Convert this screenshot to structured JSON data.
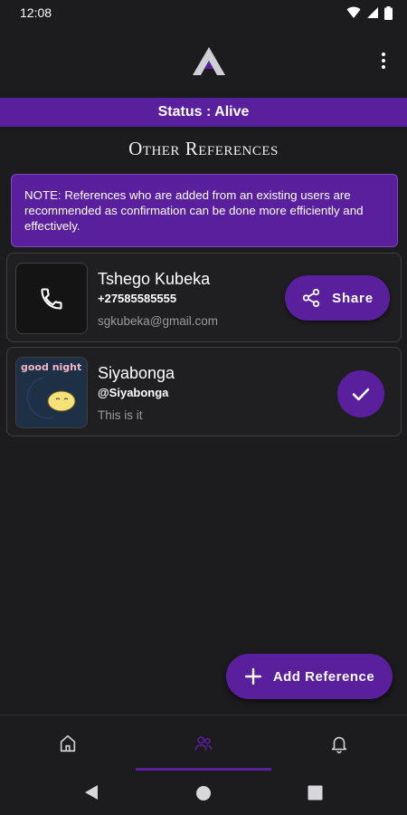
{
  "status_bar": {
    "time": "12:08"
  },
  "app": {
    "status_text": "Status : Alive",
    "section_title": "Other References"
  },
  "note": "NOTE: References who are added from an existing users are recommended as confirmation can be done more efficiently and effectively.",
  "references": [
    {
      "name": "Tshego Kubeka",
      "phone": "+27585585555",
      "email": "sgkubeka@gmail.com",
      "action_label": "Share"
    },
    {
      "name": "Siyabonga",
      "handle": "@Siyabonga",
      "bio": "This is it",
      "avatar_text": "good night"
    }
  ],
  "fab": {
    "label": "Add Reference"
  },
  "colors": {
    "accent": "#5a1f9c",
    "background": "#1c1b1d",
    "card": "#1f1e20",
    "muted_text": "#9a9a9e"
  },
  "icons": [
    "wifi-icon",
    "signal-icon",
    "battery-icon",
    "more-vert-icon",
    "phone-icon",
    "share-icon",
    "check-icon",
    "add-icon",
    "home-icon",
    "people-icon",
    "bell-icon",
    "back-icon",
    "home-circle-icon",
    "recents-icon"
  ]
}
